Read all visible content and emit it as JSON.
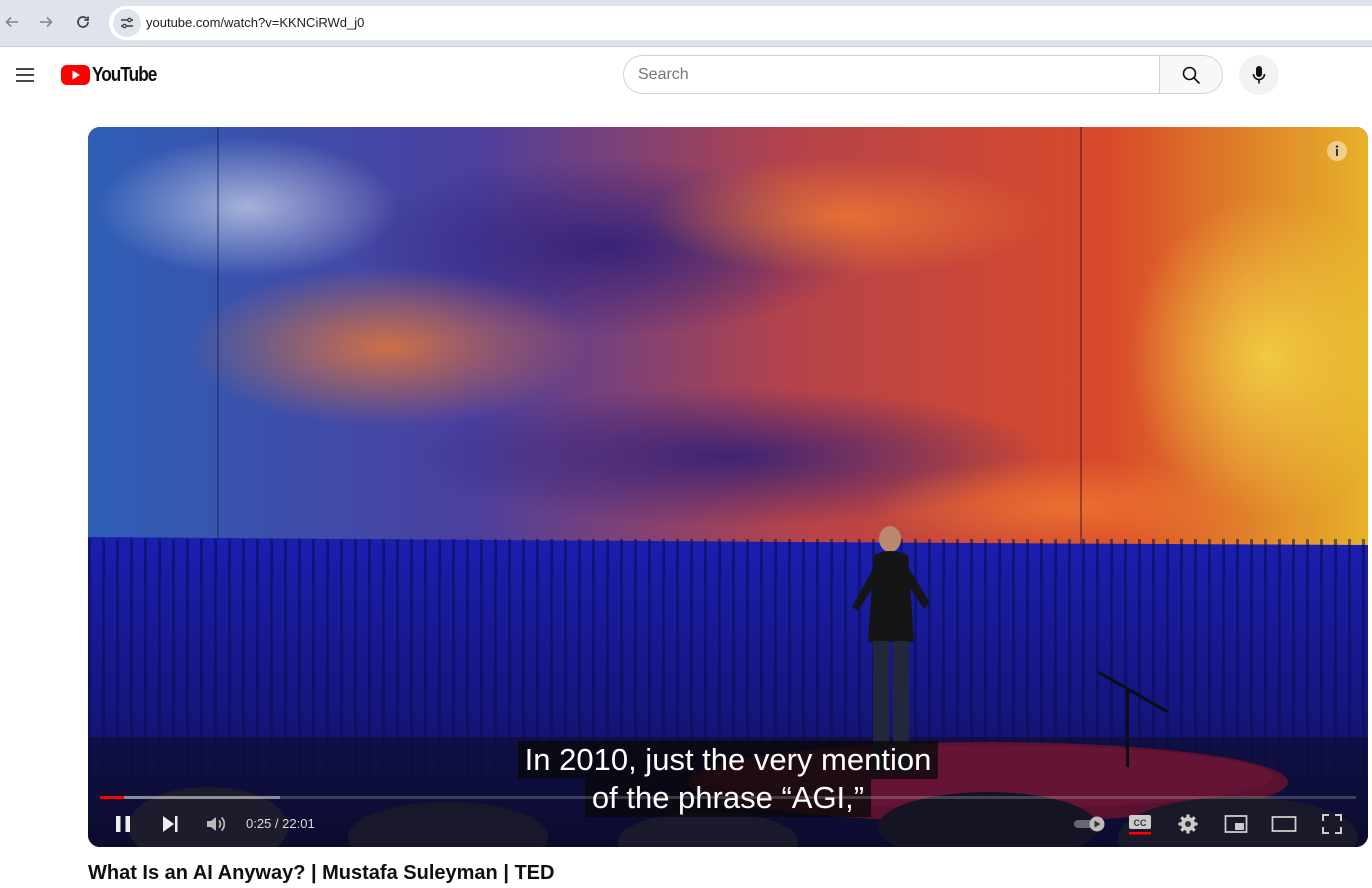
{
  "browser": {
    "url": "youtube.com/watch?v=KKNCiRWd_j0"
  },
  "header": {
    "logo_text": "YouTube",
    "search_placeholder": "Search"
  },
  "player": {
    "time_display": "0:25 / 22:01",
    "progress_fraction": 0.019,
    "caption_lines": [
      "In 2010, just the very mention",
      "of the phrase “AGI,”"
    ]
  },
  "video": {
    "title": "What Is an AI Anyway? | Mustafa Suleyman | TED"
  },
  "colors": {
    "brand_red": "#ff0000"
  }
}
